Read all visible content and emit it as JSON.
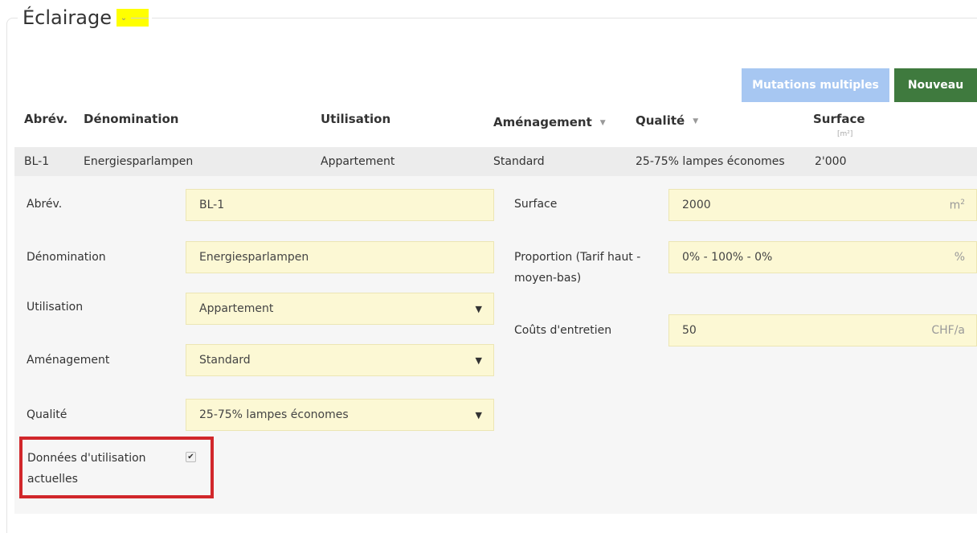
{
  "section": {
    "title": "Éclairage",
    "chevron_icon": "chevron-down-icon"
  },
  "toolbar": {
    "multi_label": "Mutations multiples",
    "new_label": "Nouveau"
  },
  "table": {
    "headers": {
      "abrev": "Abrév.",
      "denomination": "Dénomination",
      "utilisation": "Utilisation",
      "amenagement": "Aménagement",
      "qualite": "Qualité",
      "surface": "Surface",
      "surface_unit": "[m²]"
    },
    "row": {
      "abrev": "BL-1",
      "denomination": "Energiesparlampen",
      "utilisation": "Appartement",
      "amenagement": "Standard",
      "qualite": "25-75% lampes économes",
      "surface": "2'000"
    }
  },
  "form": {
    "abrev_label": "Abrév.",
    "abrev_value": "BL-1",
    "denomination_label": "Dénomination",
    "denomination_value": "Energiesparlampen",
    "utilisation_label": "Utilisation",
    "utilisation_value": "Appartement",
    "amenagement_label": "Aménagement",
    "amenagement_value": "Standard",
    "qualite_label": "Qualité",
    "qualite_value": "25-75% lampes économes",
    "donnees_label_1": "Données d'utilisation",
    "donnees_label_2": "actuelles",
    "donnees_checked": true,
    "surface_label": "Surface",
    "surface_value": "2000",
    "surface_unit": "m",
    "surface_unit_exp": "2",
    "proportion_label_1": "Proportion (Tarif haut -",
    "proportion_label_2": "moyen-bas)",
    "proportion_value": "0% - 100% - 0%",
    "proportion_unit": "%",
    "couts_label": "Coûts d'entretien",
    "couts_value": "50",
    "couts_unit": "CHF/a"
  },
  "colors": {
    "input_bg": "#fcf8d4",
    "btn_multi": "#a7c7f2",
    "btn_new": "#3f7a3e",
    "highlight": "#d1272b"
  }
}
